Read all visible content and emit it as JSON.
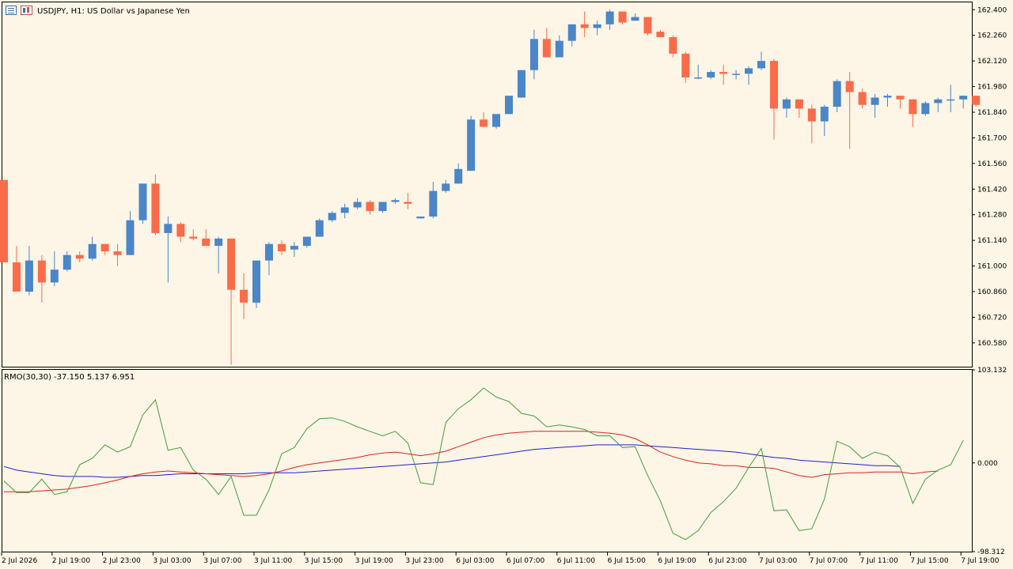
{
  "header": {
    "symbol_title": "USDJPY, H1:  US Dollar vs Japanese Yen",
    "indicator_title": "RMO(30,30) -37.150 5.137 6.951"
  },
  "icons": [
    "window-list-icon",
    "chart-type-icon"
  ],
  "colors": {
    "background": "#fdf5e6",
    "bull": "#4a86c8",
    "bear": "#fa6b4a",
    "indicator_main": "#3fa03f",
    "indicator_signal": "#e02020",
    "indicator_slow": "#2020d0"
  },
  "chart_data": [
    {
      "type": "candlestick",
      "title": "USDJPY, H1:  US Dollar vs Japanese Yen",
      "y_ticks": [
        "162.400",
        "162.260",
        "162.120",
        "161.980",
        "161.840",
        "161.700",
        "161.560",
        "161.420",
        "161.280",
        "161.140",
        "161.000",
        "160.860",
        "160.720",
        "160.580"
      ],
      "ylim": [
        160.45,
        162.44
      ],
      "x_ticks": [
        "2 Jul 2026",
        "2 Jul 19:00",
        "2 Jul 23:00",
        "3 Jul 03:00",
        "3 Jul 07:00",
        "3 Jul 11:00",
        "3 Jul 15:00",
        "3 Jul 19:00",
        "3 Jul 23:00",
        "6 Jul 03:00",
        "6 Jul 07:00",
        "6 Jul 11:00",
        "6 Jul 15:00",
        "6 Jul 19:00",
        "6 Jul 23:00",
        "7 Jul 03:00",
        "7 Jul 07:00",
        "7 Jul 11:00",
        "7 Jul 15:00",
        "7 Jul 19:00"
      ],
      "candles": [
        {
          "o": 161.47,
          "h": 161.47,
          "l": 161.02,
          "c": 161.02
        },
        {
          "o": 161.02,
          "h": 161.11,
          "l": 160.86,
          "c": 160.86
        },
        {
          "o": 160.86,
          "h": 161.11,
          "l": 160.84,
          "c": 161.03
        },
        {
          "o": 161.03,
          "h": 161.06,
          "l": 160.8,
          "c": 160.91
        },
        {
          "o": 160.91,
          "h": 161.08,
          "l": 160.89,
          "c": 160.98
        },
        {
          "o": 160.98,
          "h": 161.08,
          "l": 160.97,
          "c": 161.06
        },
        {
          "o": 161.06,
          "h": 161.08,
          "l": 161.02,
          "c": 161.04
        },
        {
          "o": 161.04,
          "h": 161.16,
          "l": 161.03,
          "c": 161.12
        },
        {
          "o": 161.12,
          "h": 161.12,
          "l": 161.06,
          "c": 161.08
        },
        {
          "o": 161.08,
          "h": 161.12,
          "l": 161.0,
          "c": 161.06
        },
        {
          "o": 161.06,
          "h": 161.3,
          "l": 161.06,
          "c": 161.25
        },
        {
          "o": 161.25,
          "h": 161.45,
          "l": 161.23,
          "c": 161.45
        },
        {
          "o": 161.45,
          "h": 161.5,
          "l": 161.17,
          "c": 161.18
        },
        {
          "o": 161.18,
          "h": 161.27,
          "l": 160.91,
          "c": 161.23
        },
        {
          "o": 161.23,
          "h": 161.24,
          "l": 161.13,
          "c": 161.16
        },
        {
          "o": 161.16,
          "h": 161.2,
          "l": 161.14,
          "c": 161.15
        },
        {
          "o": 161.15,
          "h": 161.2,
          "l": 161.11,
          "c": 161.11
        },
        {
          "o": 161.11,
          "h": 161.16,
          "l": 160.96,
          "c": 161.15
        },
        {
          "o": 161.15,
          "h": 161.15,
          "l": 160.46,
          "c": 160.87
        },
        {
          "o": 160.87,
          "h": 160.96,
          "l": 160.71,
          "c": 160.8
        },
        {
          "o": 160.8,
          "h": 161.03,
          "l": 160.77,
          "c": 161.03
        },
        {
          "o": 161.03,
          "h": 161.13,
          "l": 160.95,
          "c": 161.12
        },
        {
          "o": 161.12,
          "h": 161.14,
          "l": 161.06,
          "c": 161.08
        },
        {
          "o": 161.09,
          "h": 161.13,
          "l": 161.05,
          "c": 161.11
        },
        {
          "o": 161.11,
          "h": 161.16,
          "l": 161.1,
          "c": 161.16
        },
        {
          "o": 161.16,
          "h": 161.26,
          "l": 161.16,
          "c": 161.25
        },
        {
          "o": 161.25,
          "h": 161.3,
          "l": 161.24,
          "c": 161.29
        },
        {
          "o": 161.29,
          "h": 161.34,
          "l": 161.26,
          "c": 161.32
        },
        {
          "o": 161.32,
          "h": 161.37,
          "l": 161.31,
          "c": 161.35
        },
        {
          "o": 161.35,
          "h": 161.36,
          "l": 161.28,
          "c": 161.3
        },
        {
          "o": 161.3,
          "h": 161.35,
          "l": 161.29,
          "c": 161.35
        },
        {
          "o": 161.35,
          "h": 161.37,
          "l": 161.34,
          "c": 161.36
        },
        {
          "o": 161.35,
          "h": 161.4,
          "l": 161.31,
          "c": 161.34
        },
        {
          "o": 161.26,
          "h": 161.27,
          "l": 161.26,
          "c": 161.27
        },
        {
          "o": 161.27,
          "h": 161.46,
          "l": 161.26,
          "c": 161.41
        },
        {
          "o": 161.41,
          "h": 161.47,
          "l": 161.4,
          "c": 161.45
        },
        {
          "o": 161.45,
          "h": 161.56,
          "l": 161.45,
          "c": 161.53
        },
        {
          "o": 161.52,
          "h": 161.82,
          "l": 161.52,
          "c": 161.8
        },
        {
          "o": 161.8,
          "h": 161.84,
          "l": 161.76,
          "c": 161.76
        },
        {
          "o": 161.76,
          "h": 161.83,
          "l": 161.75,
          "c": 161.83
        },
        {
          "o": 161.83,
          "h": 161.93,
          "l": 161.83,
          "c": 161.93
        },
        {
          "o": 161.92,
          "h": 162.07,
          "l": 161.92,
          "c": 162.07
        },
        {
          "o": 162.07,
          "h": 162.29,
          "l": 162.02,
          "c": 162.24
        },
        {
          "o": 162.24,
          "h": 162.3,
          "l": 162.14,
          "c": 162.14
        },
        {
          "o": 162.14,
          "h": 162.26,
          "l": 162.14,
          "c": 162.23
        },
        {
          "o": 162.23,
          "h": 162.32,
          "l": 162.2,
          "c": 162.32
        },
        {
          "o": 162.32,
          "h": 162.39,
          "l": 162.25,
          "c": 162.3
        },
        {
          "o": 162.3,
          "h": 162.34,
          "l": 162.26,
          "c": 162.32
        },
        {
          "o": 162.32,
          "h": 162.4,
          "l": 162.29,
          "c": 162.39
        },
        {
          "o": 162.39,
          "h": 162.39,
          "l": 162.32,
          "c": 162.33
        },
        {
          "o": 162.34,
          "h": 162.38,
          "l": 162.34,
          "c": 162.36
        },
        {
          "o": 162.36,
          "h": 162.36,
          "l": 162.26,
          "c": 162.27
        },
        {
          "o": 162.28,
          "h": 162.29,
          "l": 162.25,
          "c": 162.25
        },
        {
          "o": 162.25,
          "h": 162.26,
          "l": 162.14,
          "c": 162.16
        },
        {
          "o": 162.16,
          "h": 162.17,
          "l": 162.0,
          "c": 162.03
        },
        {
          "o": 162.03,
          "h": 162.1,
          "l": 162.02,
          "c": 162.03
        },
        {
          "o": 162.03,
          "h": 162.07,
          "l": 162.02,
          "c": 162.06
        },
        {
          "o": 162.06,
          "h": 162.1,
          "l": 161.99,
          "c": 162.05
        },
        {
          "o": 162.05,
          "h": 162.07,
          "l": 162.02,
          "c": 162.05
        },
        {
          "o": 162.05,
          "h": 162.09,
          "l": 161.99,
          "c": 162.08
        },
        {
          "o": 162.08,
          "h": 162.17,
          "l": 162.07,
          "c": 162.12
        },
        {
          "o": 162.12,
          "h": 162.13,
          "l": 161.69,
          "c": 161.86
        },
        {
          "o": 161.86,
          "h": 161.92,
          "l": 161.81,
          "c": 161.91
        },
        {
          "o": 161.91,
          "h": 161.91,
          "l": 161.81,
          "c": 161.86
        },
        {
          "o": 161.86,
          "h": 161.88,
          "l": 161.67,
          "c": 161.79
        },
        {
          "o": 161.79,
          "h": 161.88,
          "l": 161.71,
          "c": 161.87
        },
        {
          "o": 161.87,
          "h": 162.02,
          "l": 161.84,
          "c": 162.01
        },
        {
          "o": 162.01,
          "h": 162.06,
          "l": 161.64,
          "c": 161.95
        },
        {
          "o": 161.95,
          "h": 161.97,
          "l": 161.86,
          "c": 161.88
        },
        {
          "o": 161.88,
          "h": 161.94,
          "l": 161.81,
          "c": 161.92
        },
        {
          "o": 161.92,
          "h": 161.94,
          "l": 161.87,
          "c": 161.93
        },
        {
          "o": 161.93,
          "h": 161.93,
          "l": 161.86,
          "c": 161.91
        },
        {
          "o": 161.91,
          "h": 161.91,
          "l": 161.76,
          "c": 161.83
        },
        {
          "o": 161.83,
          "h": 161.9,
          "l": 161.82,
          "c": 161.89
        },
        {
          "o": 161.89,
          "h": 161.92,
          "l": 161.84,
          "c": 161.91
        },
        {
          "o": 161.91,
          "h": 161.99,
          "l": 161.84,
          "c": 161.91
        },
        {
          "o": 161.91,
          "h": 161.93,
          "l": 161.86,
          "c": 161.93
        },
        {
          "o": 161.93,
          "h": 161.93,
          "l": 161.87,
          "c": 161.88
        }
      ]
    },
    {
      "type": "line",
      "title": "RMO(30,30) -37.150 5.137 6.951",
      "y_ticks": [
        "103.132",
        "0.000",
        "-98.312"
      ],
      "ylim": [
        -98.312,
        103.132
      ],
      "series": [
        {
          "color": "#3fa03f",
          "values": [
            -20,
            -33,
            -33,
            -18,
            -35,
            -32,
            -2,
            5,
            20,
            12,
            18,
            53,
            70,
            14,
            17,
            -8,
            -18,
            -35,
            -15,
            -58,
            -58,
            -30,
            10,
            17,
            38,
            49,
            50,
            46,
            40,
            35,
            30,
            35,
            22,
            -22,
            -24,
            45,
            60,
            70,
            83,
            73,
            68,
            55,
            52,
            40,
            42,
            40,
            37,
            30,
            30,
            17,
            18,
            -14,
            -42,
            -78,
            -85,
            -75,
            -55,
            -43,
            -28,
            -5,
            16,
            -53,
            -52,
            -75,
            -73,
            -40,
            24,
            18,
            5,
            12,
            8,
            -5,
            -45,
            -18,
            -8,
            -2,
            25
          ]
        },
        {
          "color": "#e02020",
          "values": [
            -32,
            -32,
            -32,
            -31,
            -30,
            -29,
            -27,
            -25,
            -22,
            -19,
            -15,
            -12,
            -10,
            -9,
            -10,
            -11,
            -12,
            -13,
            -14,
            -15,
            -14,
            -12,
            -9,
            -5,
            -2,
            0,
            2,
            4,
            6,
            9,
            11,
            12,
            10,
            8,
            10,
            13,
            18,
            23,
            28,
            31,
            33,
            34,
            35,
            35,
            35,
            35,
            35,
            34,
            33,
            31,
            27,
            20,
            12,
            7,
            3,
            0,
            -1,
            -3,
            -3,
            -5,
            -5,
            -6,
            -10,
            -14,
            -16,
            -13,
            -12,
            -11,
            -11,
            -10,
            -10,
            -10,
            -12,
            -10,
            -9
          ]
        },
        {
          "color": "#2020d0",
          "values": [
            -4,
            -8,
            -10,
            -12,
            -14,
            -15,
            -15,
            -15,
            -16,
            -16,
            -15,
            -14,
            -14,
            -13,
            -12,
            -12,
            -12,
            -12,
            -12,
            -12,
            -11,
            -11,
            -11,
            -11,
            -10,
            -9,
            -8,
            -7,
            -6,
            -5,
            -4,
            -3,
            -2,
            -1,
            0,
            1,
            3,
            5,
            7,
            9,
            11,
            13,
            15,
            16,
            17,
            18,
            19,
            20,
            20,
            20,
            20,
            19,
            18,
            17,
            16,
            15,
            14,
            13,
            12,
            10,
            8,
            6,
            5,
            3,
            2,
            1,
            0,
            -1,
            -2,
            -3,
            -3,
            -4
          ]
        }
      ]
    }
  ],
  "x_axis": {
    "labels": [
      "2 Jul 2026",
      "2 Jul 19:00",
      "2 Jul 23:00",
      "3 Jul 03:00",
      "3 Jul 07:00",
      "3 Jul 11:00",
      "3 Jul 15:00",
      "3 Jul 19:00",
      "3 Jul 23:00",
      "6 Jul 03:00",
      "6 Jul 07:00",
      "6 Jul 11:00",
      "6 Jul 15:00",
      "6 Jul 19:00",
      "6 Jul 23:00",
      "7 Jul 03:00",
      "7 Jul 07:00",
      "7 Jul 11:00",
      "7 Jul 15:00",
      "7 Jul 19:00"
    ]
  }
}
